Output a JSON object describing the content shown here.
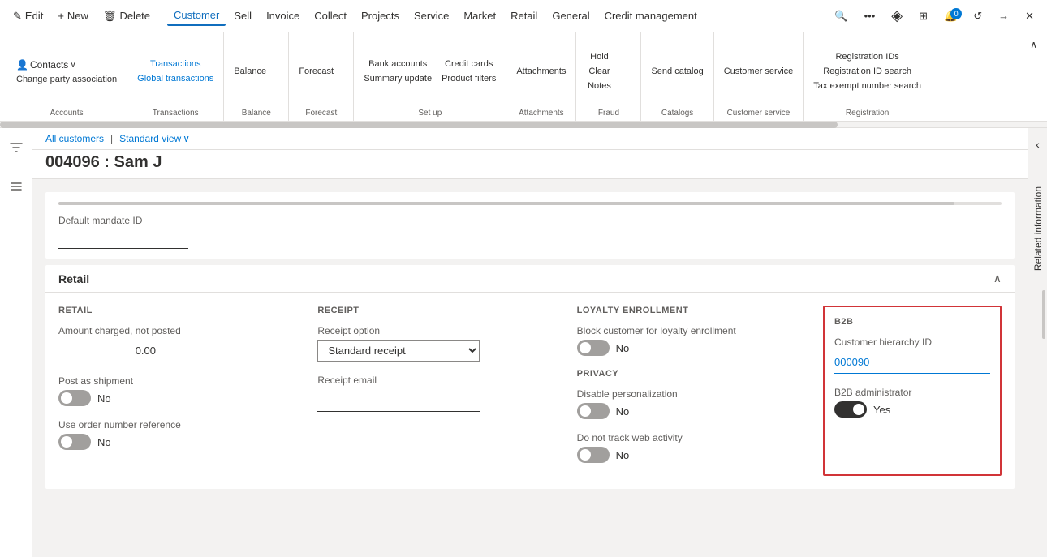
{
  "toolbar": {
    "edit_label": "Edit",
    "new_label": "New",
    "delete_label": "Delete",
    "customer_label": "Customer",
    "sell_label": "Sell",
    "invoice_label": "Invoice",
    "collect_label": "Collect",
    "projects_label": "Projects",
    "service_label": "Service",
    "market_label": "Market",
    "retail_label": "Retail",
    "general_label": "General",
    "credit_mgmt_label": "Credit management",
    "notifications_count": "0"
  },
  "ribbon": {
    "groups": [
      {
        "label": "Accounts",
        "items": [
          {
            "label": "Contacts",
            "icon": "👤",
            "has_arrow": true
          },
          {
            "label": "Change party association",
            "icon": "",
            "small": true
          }
        ]
      },
      {
        "label": "Transactions",
        "items": [
          {
            "label": "Transactions",
            "icon": "",
            "disabled": true
          },
          {
            "label": "Global transactions",
            "icon": "",
            "disabled": true
          }
        ]
      },
      {
        "label": "Balance",
        "items": [
          {
            "label": "Balance",
            "icon": ""
          }
        ]
      },
      {
        "label": "Forecast",
        "items": [
          {
            "label": "Forecast",
            "icon": ""
          }
        ]
      },
      {
        "label": "Set up",
        "items": [
          {
            "label": "Bank accounts",
            "icon": ""
          },
          {
            "label": "Summary update",
            "icon": ""
          },
          {
            "label": "Credit cards",
            "icon": ""
          },
          {
            "label": "Product filters",
            "icon": ""
          }
        ]
      },
      {
        "label": "Attachments",
        "items": [
          {
            "label": "Attachments",
            "icon": ""
          }
        ]
      },
      {
        "label": "Fraud",
        "items": [
          {
            "label": "Hold",
            "icon": ""
          },
          {
            "label": "Clear",
            "icon": ""
          },
          {
            "label": "Notes",
            "icon": ""
          }
        ]
      },
      {
        "label": "Catalogs",
        "items": [
          {
            "label": "Send catalog",
            "icon": ""
          }
        ]
      },
      {
        "label": "Customer service",
        "items": [
          {
            "label": "Customer service",
            "icon": ""
          }
        ]
      },
      {
        "label": "Registration",
        "items": [
          {
            "label": "Registration IDs",
            "icon": ""
          },
          {
            "label": "Registration ID search",
            "icon": ""
          },
          {
            "label": "Tax exempt number search",
            "icon": ""
          }
        ]
      }
    ]
  },
  "breadcrumb": {
    "link_label": "All customers",
    "separator": "|",
    "view_label": "Standard view"
  },
  "page": {
    "title": "004096 : Sam J"
  },
  "mandate": {
    "label": "Default mandate ID",
    "value": ""
  },
  "retail_section": {
    "title": "Retail",
    "retail_col": {
      "label": "RETAIL",
      "amount_label": "Amount charged, not posted",
      "amount_value": "0.00",
      "post_shipment_label": "Post as shipment",
      "post_shipment_toggle": false,
      "post_shipment_text": "No",
      "order_ref_label": "Use order number reference",
      "order_ref_toggle": false,
      "order_ref_text": "No"
    },
    "receipt_col": {
      "label": "RECEIPT",
      "receipt_option_label": "Receipt option",
      "receipt_option_value": "Standard receipt",
      "receipt_email_label": "Receipt email",
      "receipt_email_value": ""
    },
    "loyalty_col": {
      "label": "LOYALTY ENROLLMENT",
      "block_label": "Block customer for loyalty enrollment",
      "block_toggle": false,
      "block_text": "No",
      "privacy_label": "PRIVACY",
      "disable_label": "Disable personalization",
      "disable_toggle": false,
      "disable_text": "No",
      "track_label": "Do not track web activity",
      "track_toggle": false,
      "track_text": "No"
    },
    "b2b_col": {
      "label": "B2B",
      "hierarchy_label": "Customer hierarchy ID",
      "hierarchy_value": "000090",
      "admin_label": "B2B administrator",
      "admin_toggle": true,
      "admin_text": "Yes"
    }
  },
  "right_panel": {
    "label": "Related information"
  },
  "icons": {
    "edit": "✎",
    "new": "+",
    "delete": "🗑",
    "search": "🔍",
    "more": "•••",
    "diamond": "◈",
    "expand": "⊞",
    "refresh": "↺",
    "arrow_right": "→",
    "close": "✕",
    "filter": "▽",
    "hamburger": "≡",
    "chevron_down": "∨",
    "chevron_up": "∧",
    "chevron_left": "‹",
    "chevron_right": "›"
  }
}
